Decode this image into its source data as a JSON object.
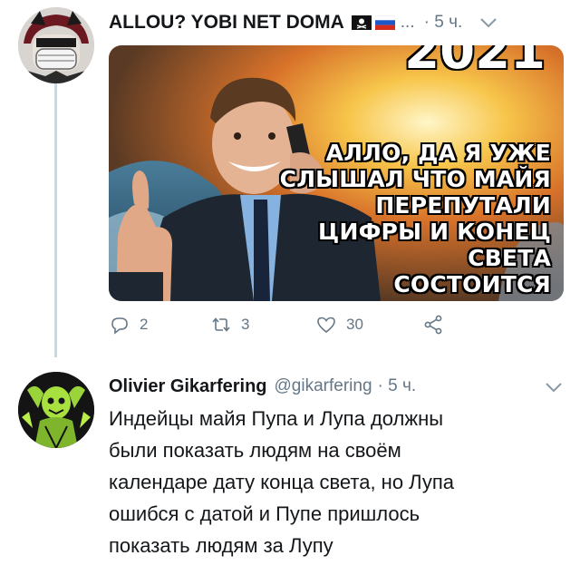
{
  "tweet1": {
    "author_name": "ALLOU? YOBI NET DOMA",
    "ellipsis": "...",
    "time": "· 5 ч.",
    "meme": {
      "year": "2021",
      "caption_lines": [
        "АЛЛО, ДА Я УЖЕ",
        "СЛЫШАЛ ЧТО МАЙЯ",
        "ПЕРЕПУТАЛИ",
        "ЦИФРЫ И КОНЕЦ СВЕТА",
        "СОСТОИТСЯ"
      ]
    },
    "actions": {
      "replies": "2",
      "retweets": "3",
      "likes": "30"
    }
  },
  "tweet2": {
    "author_name": "Olivier Gikarfering",
    "handle": "@gikarfering",
    "time": "· 5 ч.",
    "body": "Индейцы майя Пупа и Лупа должны\nбыли показать людям на своём\nкалендаре дату конца света, но Лупа\nошибся с датой  и Пупе пришлось\nпоказать людям за Лупу"
  },
  "colors": {
    "muted": "#657786",
    "thread_line": "#ccd6dd",
    "text": "#14171a"
  },
  "icons": [
    "reply-icon",
    "retweet-icon",
    "like-icon",
    "share-icon",
    "chevron-down-icon",
    "pirate-flag-icon",
    "russia-flag-icon"
  ]
}
